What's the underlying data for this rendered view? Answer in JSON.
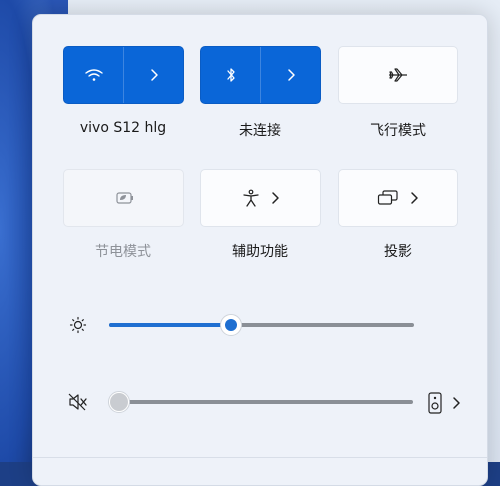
{
  "tiles": [
    {
      "label": "vivo S12 hlg",
      "icon": "wifi-icon",
      "state": "on"
    },
    {
      "label": "未连接",
      "icon": "bluetooth-icon",
      "state": "on"
    },
    {
      "label": "飞行模式",
      "icon": "airplane-icon",
      "state": "off"
    },
    {
      "label": "节电模式",
      "icon": "battery-saver-icon",
      "state": "disabled"
    },
    {
      "label": "辅助功能",
      "icon": "accessibility-icon",
      "state": "off"
    },
    {
      "label": "投影",
      "icon": "project-icon",
      "state": "off"
    }
  ],
  "brightness": {
    "icon": "brightness-icon",
    "level": 0.4
  },
  "volume": {
    "icon": "speaker-muted-icon",
    "level": 0.0,
    "output_icon": "speaker-device-icon"
  },
  "colors": {
    "accent": "#0a66d8",
    "panel": "#eef2f9"
  }
}
